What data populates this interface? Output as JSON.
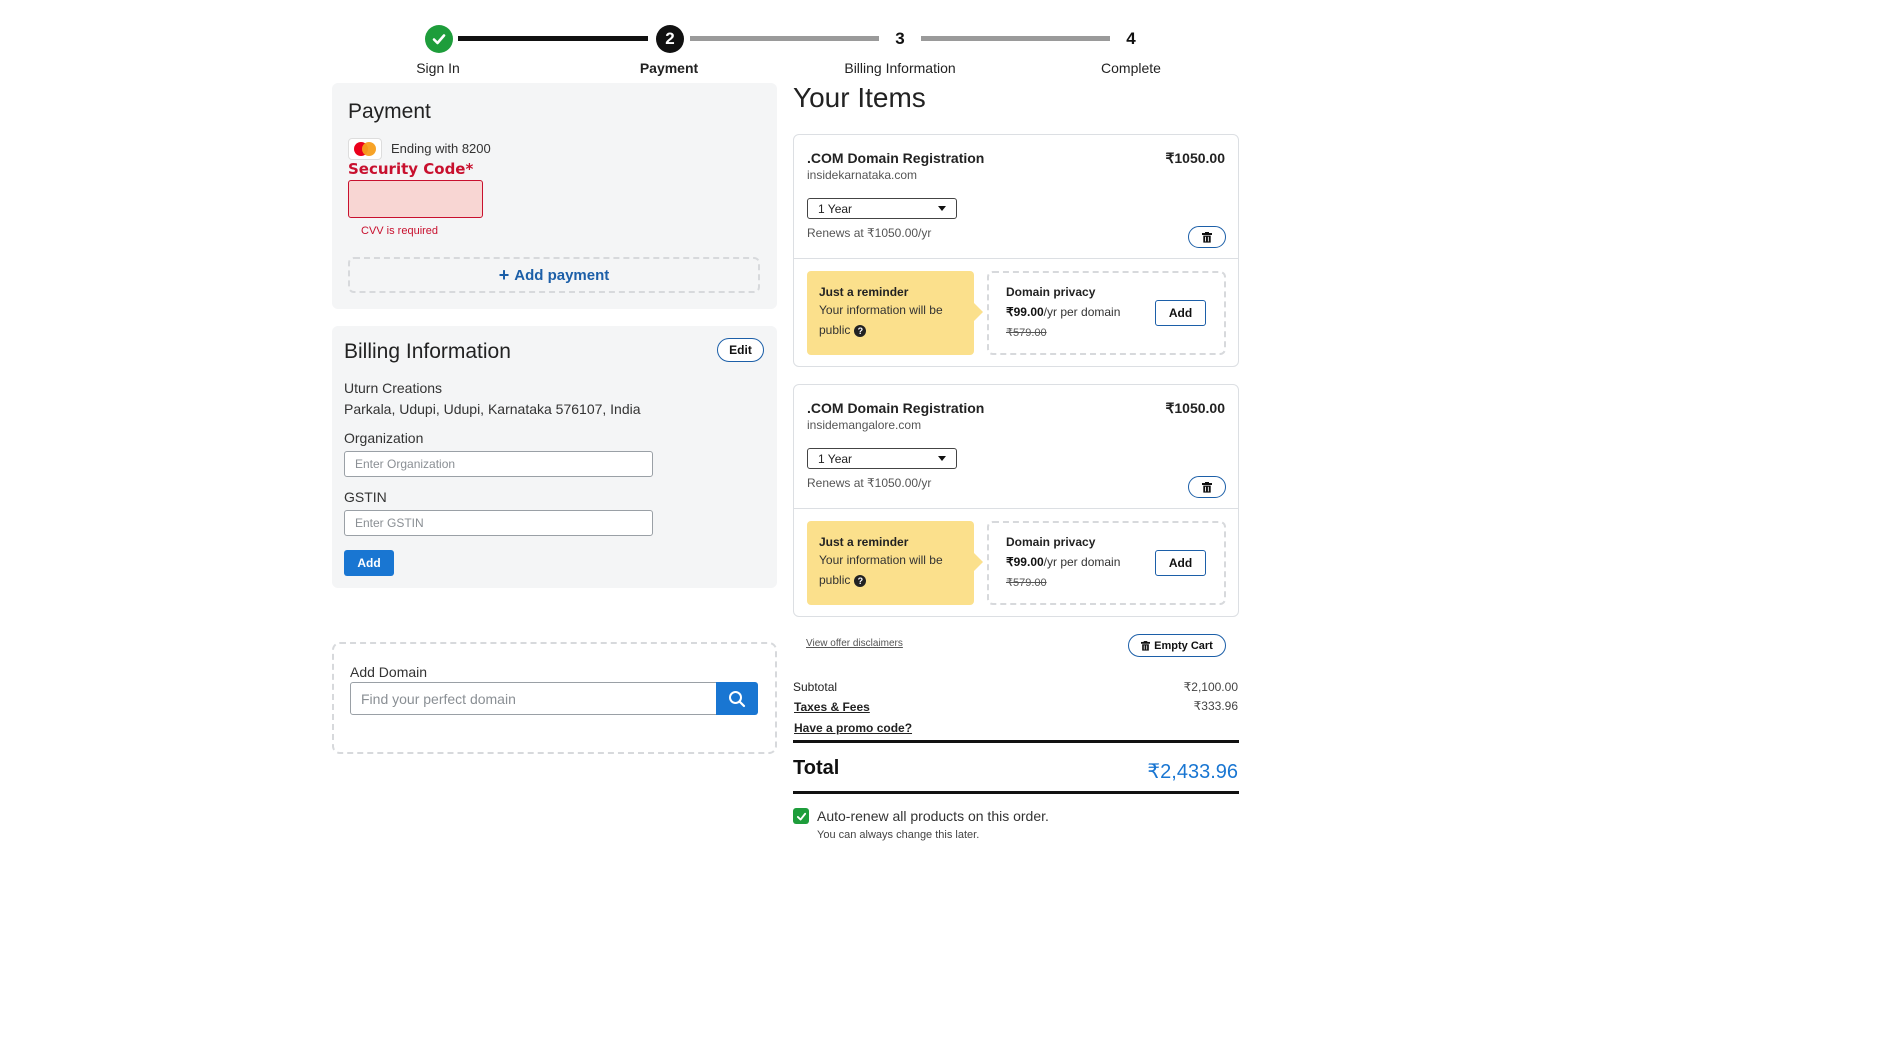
{
  "stepper": {
    "steps": [
      {
        "number": "",
        "label": "Sign In",
        "state": "done"
      },
      {
        "number": "2",
        "label": "Payment",
        "state": "current"
      },
      {
        "number": "3",
        "label": "Billing Information",
        "state": "future"
      },
      {
        "number": "4",
        "label": "Complete",
        "state": "future"
      }
    ]
  },
  "payment": {
    "title": "Payment",
    "card_text": "Ending with 8200",
    "card_brand_icon": "mastercard-icon",
    "security_code_label": "Security Code*",
    "cvv_error": "CVV is required",
    "add_payment_label": "Add payment"
  },
  "billing": {
    "title": "Billing Information",
    "edit_label": "Edit",
    "company": "Uturn Creations",
    "address": "Parkala, Udupi, Udupi, Karnataka 576107, India",
    "organization_label": "Organization",
    "organization_placeholder": "Enter Organization",
    "gstin_label": "GSTIN",
    "gstin_placeholder": "Enter GSTIN",
    "add_label": "Add"
  },
  "add_domain": {
    "label": "Add Domain",
    "placeholder": "Find your perfect domain"
  },
  "items": {
    "title": "Your Items",
    "list": [
      {
        "name": ".COM Domain Registration",
        "price": "₹1050.00",
        "domain": "insidekarnataka.com",
        "term": "1 Year",
        "renews": "Renews at ₹1050.00/yr",
        "reminder_title": "Just a reminder",
        "reminder_text": "Your information will be public",
        "privacy_title": "Domain privacy",
        "privacy_price": "₹99.00",
        "privacy_unit": "/yr per domain",
        "privacy_old_price": "₹579.00",
        "privacy_add": "Add"
      },
      {
        "name": ".COM Domain Registration",
        "price": "₹1050.00",
        "domain": "insidemangalore.com",
        "term": "1 Year",
        "renews": "Renews at ₹1050.00/yr",
        "reminder_title": "Just a reminder",
        "reminder_text": "Your information will be public",
        "privacy_title": "Domain privacy",
        "privacy_price": "₹99.00",
        "privacy_unit": "/yr per domain",
        "privacy_old_price": "₹579.00",
        "privacy_add": "Add"
      }
    ],
    "view_disclaimers": "View offer disclaimers",
    "empty_cart": "Empty Cart"
  },
  "summary": {
    "subtotal_label": "Subtotal",
    "subtotal_value": "₹2,100.00",
    "taxes_label": "Taxes & Fees",
    "taxes_value": "₹333.96",
    "promo_label": "Have a promo code?",
    "total_label": "Total",
    "total_value": "₹2,433.96",
    "autorenew_label": "Auto-renew all products on this order.",
    "autorenew_checked": true,
    "autorenew_note": "You can always change this later."
  },
  "colors": {
    "accent": "#1976d2",
    "success": "#1e9d3b",
    "error": "#c8102e",
    "reminder": "#fbe08c",
    "total": "#1976d2"
  }
}
